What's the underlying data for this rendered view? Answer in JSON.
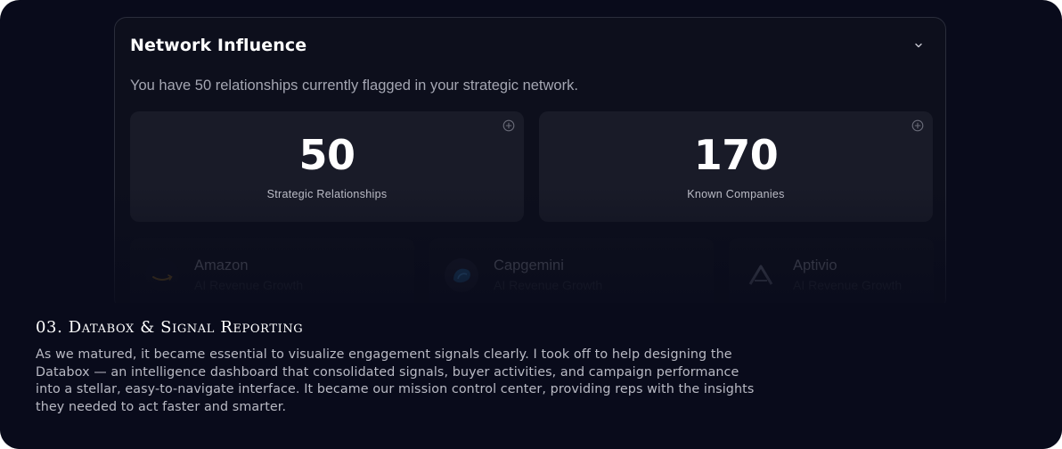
{
  "panel": {
    "title": "Network Influence",
    "description": "You have 50 relationships currently flagged in your strategic network.",
    "collapse_icon": "chevron-down-icon"
  },
  "stats": [
    {
      "value": "50",
      "label": "Strategic Relationships",
      "icon": "plus-circle-icon"
    },
    {
      "value": "170",
      "label": "Known Companies",
      "icon": "plus-circle-icon"
    }
  ],
  "companies": [
    {
      "name": "Amazon",
      "metric": "AI Revenue Growth",
      "logo": "amazon-logo"
    },
    {
      "name": "Capgemini",
      "metric": "AI Revenue Growth",
      "logo": "capgemini-logo"
    },
    {
      "name": "Aptivio",
      "metric": "AI Revenue Growth",
      "logo": "aptivio-logo"
    }
  ],
  "section": {
    "heading": "03. Databox & Signal Reporting",
    "body": "As we matured, it became essential to visualize engagement signals clearly. I took off to help designing the Databox — an intelligence dashboard that consolidated signals, buyer activities, and campaign performance into a stellar, easy-to-navigate interface. It became our mission control center, providing reps with the insights they needed to act faster and smarter."
  },
  "colors": {
    "background": "#090b1b",
    "panel": "#0d0f1c",
    "card": "#191b28",
    "text_primary": "#ffffff",
    "text_secondary": "#a4a6b2"
  }
}
